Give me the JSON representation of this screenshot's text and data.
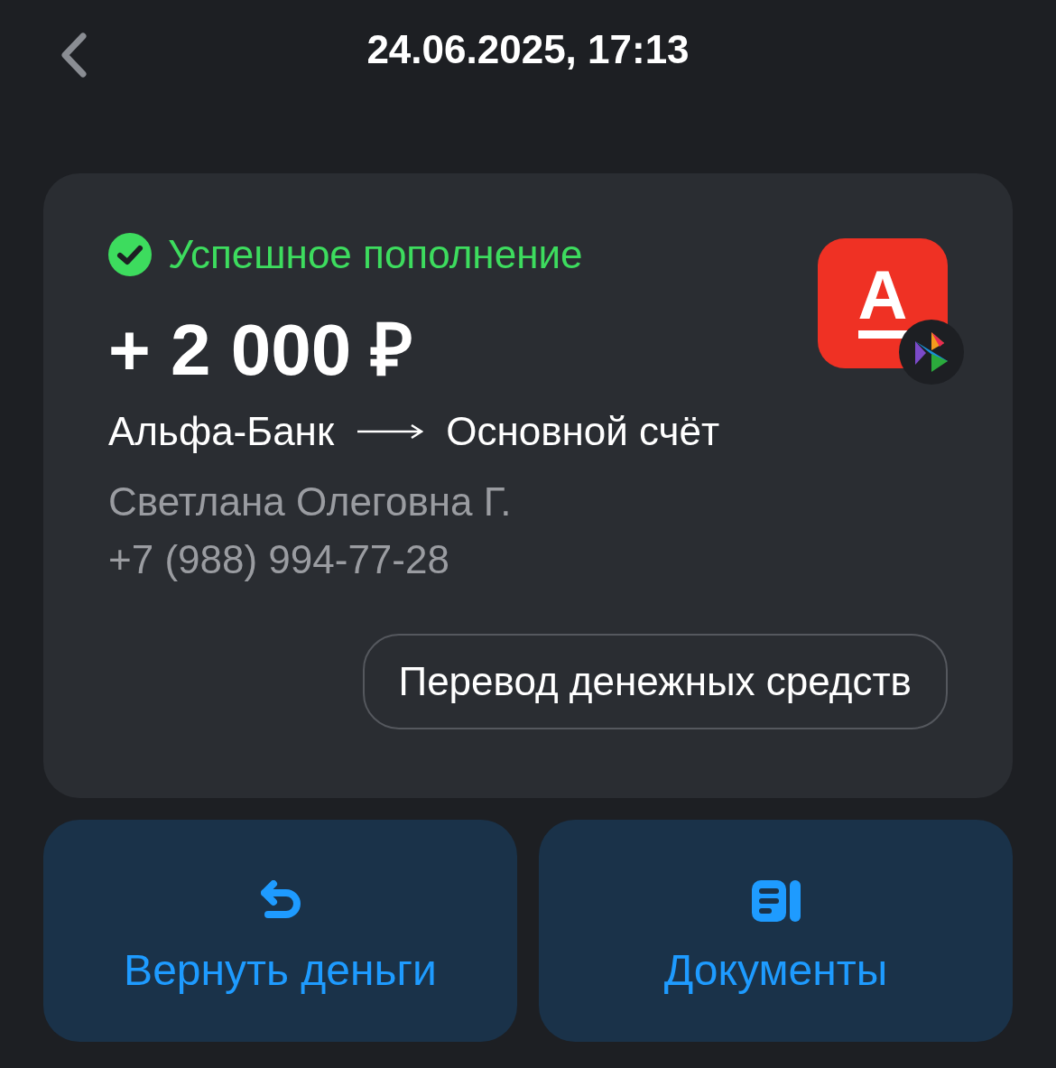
{
  "header": {
    "title": "24.06.2025, 17:13"
  },
  "operation": {
    "status": {
      "kind": "success",
      "text": "Успешное пополнение"
    },
    "amount": "+ 2 000 ₽",
    "from": "Альфа-Банк",
    "to": "Основной счёт",
    "counterparty": "Светлана Олеговна Г.",
    "phone": "+7 (988) 994-77-28",
    "bank_logo": {
      "letter": "А"
    },
    "category": "Перевод денежных средств"
  },
  "actions": [
    {
      "kind": "refund",
      "label": "Вернуть деньги"
    },
    {
      "kind": "documents",
      "label": "Документы"
    }
  ]
}
